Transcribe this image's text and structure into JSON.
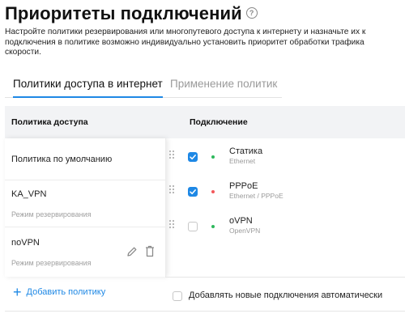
{
  "page": {
    "title": "Приоритеты подключений",
    "help_icon": "?",
    "description_lines": [
      "Настройте политики резервирования или многопутевого доступа к интернету и назначьте их к",
      "подключения в политике возможно индивидуально установить приоритет обработки трафика",
      "скорости."
    ]
  },
  "tabs": [
    {
      "label": "Политики доступа в интернет",
      "active": true
    },
    {
      "label": "Применение политик",
      "active": false
    }
  ],
  "table": {
    "col_policy": "Политика доступа",
    "col_connection": "Подключение"
  },
  "policies": [
    {
      "name": "Политика по умолчанию",
      "mode": ""
    },
    {
      "name": "KA_VPN",
      "mode": "Режим резервирования"
    },
    {
      "name": "noVPN",
      "mode": "Режим резервирования",
      "icons": [
        "edit-icon",
        "delete-icon"
      ]
    }
  ],
  "connections": [
    {
      "name": "Статика",
      "type": "Ethernet",
      "checked": true,
      "status_color": "#2eb85c"
    },
    {
      "name": "PPPoE",
      "type": "Ethernet / PPPoE",
      "checked": true,
      "status_color": "#f2585b"
    },
    {
      "name": "oVPN",
      "type": "OpenVPN",
      "checked": false,
      "status_color": "#2eb85c"
    }
  ],
  "actions": {
    "add_policy": "Добавить политику",
    "add_policy_icon": "+",
    "auto_add_label": "Добавлять новые подключения автоматически",
    "auto_add_checked": false
  },
  "colors": {
    "accent": "#1e88e5",
    "status_online": "#2eb85c",
    "status_error": "#f2585b"
  }
}
